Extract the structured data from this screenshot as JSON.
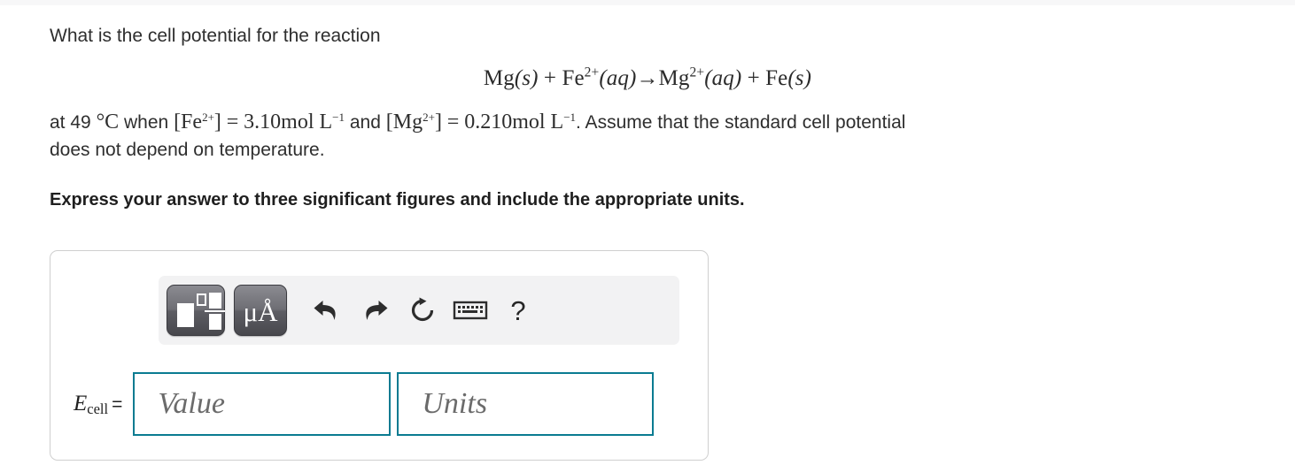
{
  "question": {
    "intro": "What is the cell potential for the reaction",
    "equation": {
      "reactant1": "Mg",
      "reactant1_state": "(s)",
      "plus1": "+",
      "reactant2": "Fe",
      "reactant2_charge": "2+",
      "reactant2_state": "(aq)",
      "arrow": "→",
      "product1": "Mg",
      "product1_charge": "2+",
      "product1_state": "(aq)",
      "plus2": "+",
      "product2": "Fe",
      "product2_state": "(s)",
      "full_text": "Mg(s) + Fe2+(aq)→Mg2+(aq) + Fe(s)"
    },
    "conditions": {
      "prefix": "at 49",
      "temperature_unit": "°C",
      "when": "when",
      "conc1_open": "[Fe",
      "conc1_charge": "2+",
      "conc1_close": "]",
      "equals1": "=",
      "conc1_value": "3.10mol L",
      "conc1_exp": "−1",
      "and": "and",
      "conc2_open": "[Mg",
      "conc2_charge": "2+",
      "conc2_close": "]",
      "equals2": "=",
      "conc2_value": "0.210mol L",
      "conc2_exp": "−1",
      "tail": ". Assume that the standard cell potential",
      "line2": "does not depend on temperature."
    },
    "instruction": "Express your answer to three significant figures and include the appropriate units."
  },
  "answer_panel": {
    "toolbar": {
      "template_button_label": "math-template",
      "units_button_label": "μÅ",
      "undo_label": "undo",
      "redo_label": "redo",
      "reset_label": "reset",
      "keyboard_label": "keyboard",
      "help_label": "?"
    },
    "label_symbol": "E",
    "label_sub": "cell",
    "label_equals": "=",
    "value_field": {
      "placeholder": "Value",
      "value": ""
    },
    "units_field": {
      "placeholder": "Units",
      "value": ""
    }
  },
  "colors": {
    "field_border": "#0a7b91",
    "panel_border": "#cfcfcf",
    "toolbar_bg": "#f2f2f3",
    "text": "#2e2e2e",
    "top_strip": "#f7f7f8"
  }
}
